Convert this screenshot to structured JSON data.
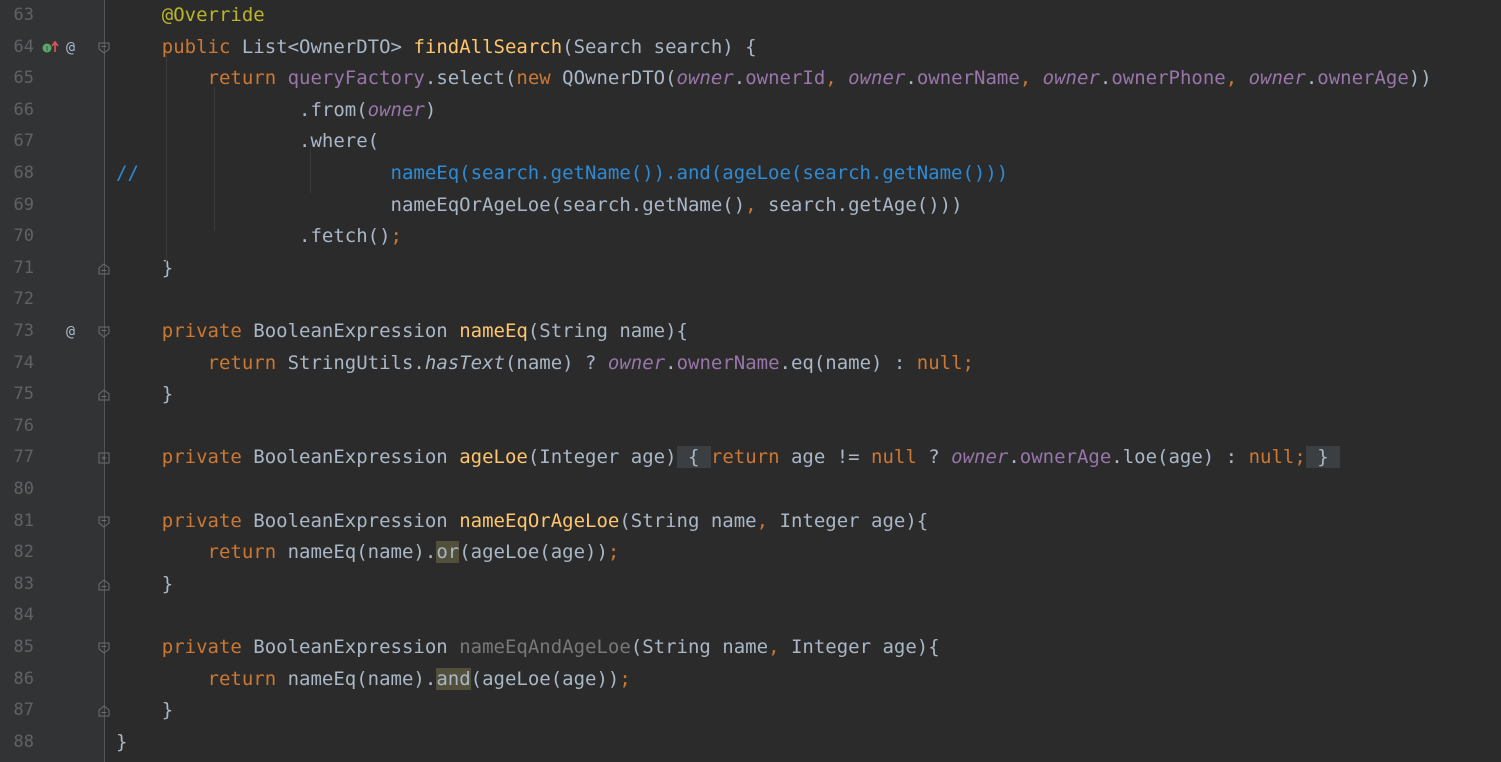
{
  "editor": {
    "lines": [
      {
        "num": "63",
        "tokens": [
          {
            "t": "    "
          },
          {
            "t": "@Override",
            "c": "ann"
          }
        ]
      },
      {
        "num": "64",
        "icons": [
          "implement",
          "override"
        ],
        "fold": "open",
        "tokens": [
          {
            "t": "    "
          },
          {
            "t": "public ",
            "c": "kw"
          },
          {
            "t": "List<OwnerDTO> "
          },
          {
            "t": "findAllSearch",
            "c": "fn"
          },
          {
            "t": "(Search search) {"
          }
        ]
      },
      {
        "num": "65",
        "tokens": [
          {
            "t": "        "
          },
          {
            "t": "return ",
            "c": "kw"
          },
          {
            "t": "queryFactory",
            "c": "fld"
          },
          {
            "t": ".select("
          },
          {
            "t": "new ",
            "c": "kw"
          },
          {
            "t": "QOwnerDTO("
          },
          {
            "t": "owner",
            "c": "var"
          },
          {
            "t": "."
          },
          {
            "t": "ownerId",
            "c": "fld"
          },
          {
            "t": ", ",
            "c": "kw"
          },
          {
            "t": "owner",
            "c": "var"
          },
          {
            "t": "."
          },
          {
            "t": "ownerName",
            "c": "fld"
          },
          {
            "t": ", ",
            "c": "kw"
          },
          {
            "t": "owner",
            "c": "var"
          },
          {
            "t": "."
          },
          {
            "t": "ownerPhone",
            "c": "fld"
          },
          {
            "t": ", ",
            "c": "kw"
          },
          {
            "t": "owner",
            "c": "var"
          },
          {
            "t": "."
          },
          {
            "t": "ownerAge",
            "c": "fld"
          },
          {
            "t": "))"
          }
        ]
      },
      {
        "num": "66",
        "tokens": [
          {
            "t": "                .from("
          },
          {
            "t": "owner",
            "c": "var"
          },
          {
            "t": ")"
          }
        ]
      },
      {
        "num": "67",
        "tokens": [
          {
            "t": "                .where("
          }
        ]
      },
      {
        "num": "68",
        "tokens": [
          {
            "t": "//                      nameEq(search.getName()).and(ageLoe(search.getName()))",
            "c": "cmt"
          }
        ]
      },
      {
        "num": "69",
        "tokens": [
          {
            "t": "                        nameEqOrAgeLoe(search.getName()"
          },
          {
            "t": ", ",
            "c": "kw"
          },
          {
            "t": "search.getAge()))"
          }
        ]
      },
      {
        "num": "70",
        "tokens": [
          {
            "t": "                .fetch()"
          },
          {
            "t": ";",
            "c": "kw"
          }
        ]
      },
      {
        "num": "71",
        "fold": "close",
        "tokens": [
          {
            "t": "    }"
          }
        ]
      },
      {
        "num": "72",
        "tokens": []
      },
      {
        "num": "73",
        "icons": [
          "override"
        ],
        "fold": "open",
        "tokens": [
          {
            "t": "    "
          },
          {
            "t": "private ",
            "c": "kw"
          },
          {
            "t": "BooleanExpression "
          },
          {
            "t": "nameEq",
            "c": "fn"
          },
          {
            "t": "(String name){"
          }
        ]
      },
      {
        "num": "74",
        "tokens": [
          {
            "t": "        "
          },
          {
            "t": "return ",
            "c": "kw"
          },
          {
            "t": "StringUtils."
          },
          {
            "t": "hasText",
            "c": "st"
          },
          {
            "t": "(name) ? "
          },
          {
            "t": "owner",
            "c": "var"
          },
          {
            "t": "."
          },
          {
            "t": "ownerName",
            "c": "fld"
          },
          {
            "t": ".eq(name) : "
          },
          {
            "t": "null;",
            "c": "kw"
          }
        ]
      },
      {
        "num": "75",
        "fold": "close",
        "tokens": [
          {
            "t": "    }"
          }
        ]
      },
      {
        "num": "76",
        "tokens": []
      },
      {
        "num": "77",
        "fold": "collapsed",
        "tokens": [
          {
            "t": "    "
          },
          {
            "t": "private ",
            "c": "kw"
          },
          {
            "t": "BooleanExpression "
          },
          {
            "t": "ageLoe",
            "c": "fn"
          },
          {
            "t": "(Integer age)"
          },
          {
            "t": " { ",
            "c": "fbox"
          },
          {
            "t": "return ",
            "c": "kw"
          },
          {
            "t": "age != "
          },
          {
            "t": "null ",
            "c": "kw"
          },
          {
            "t": "? "
          },
          {
            "t": "owner",
            "c": "var"
          },
          {
            "t": "."
          },
          {
            "t": "ownerAge",
            "c": "fld"
          },
          {
            "t": ".loe(age) : "
          },
          {
            "t": "null;",
            "c": "kw"
          },
          {
            "t": " } ",
            "c": "fbox"
          }
        ]
      },
      {
        "num": "80",
        "tokens": []
      },
      {
        "num": "81",
        "fold": "open",
        "tokens": [
          {
            "t": "    "
          },
          {
            "t": "private ",
            "c": "kw"
          },
          {
            "t": "BooleanExpression "
          },
          {
            "t": "nameEqOrAgeLoe",
            "c": "fn"
          },
          {
            "t": "(String name"
          },
          {
            "t": ", ",
            "c": "kw"
          },
          {
            "t": "Integer age){"
          }
        ]
      },
      {
        "num": "82",
        "tokens": [
          {
            "t": "        "
          },
          {
            "t": "return ",
            "c": "kw"
          },
          {
            "t": "nameEq(name)."
          },
          {
            "t": "or",
            "c": "hlw"
          },
          {
            "t": "(ageLoe(age))"
          },
          {
            "t": ";",
            "c": "kw"
          }
        ]
      },
      {
        "num": "83",
        "fold": "close",
        "tokens": [
          {
            "t": "    }"
          }
        ]
      },
      {
        "num": "84",
        "tokens": []
      },
      {
        "num": "85",
        "fold": "open",
        "tokens": [
          {
            "t": "    "
          },
          {
            "t": "private ",
            "c": "kw"
          },
          {
            "t": "BooleanExpression "
          },
          {
            "t": "nameEqAndAgeLoe",
            "c": "dim"
          },
          {
            "t": "(String name"
          },
          {
            "t": ", ",
            "c": "kw"
          },
          {
            "t": "Integer age){"
          }
        ]
      },
      {
        "num": "86",
        "tokens": [
          {
            "t": "        "
          },
          {
            "t": "return ",
            "c": "kw"
          },
          {
            "t": "nameEq(name)."
          },
          {
            "t": "and",
            "c": "hlw"
          },
          {
            "t": "(ageLoe(age))"
          },
          {
            "t": ";",
            "c": "kw"
          }
        ]
      },
      {
        "num": "87",
        "fold": "close",
        "tokens": [
          {
            "t": "    }"
          }
        ]
      },
      {
        "num": "88",
        "tokens": [
          {
            "t": "}"
          }
        ]
      }
    ]
  },
  "colors": {
    "background": "#2b2b2b",
    "gutter": "#313335",
    "keyword": "#cc7832",
    "annotation": "#bbb529",
    "method": "#ffc66d",
    "field": "#9876aa",
    "comment": "#2d8bd6",
    "text": "#a9b7c6",
    "line_number": "#606366"
  }
}
